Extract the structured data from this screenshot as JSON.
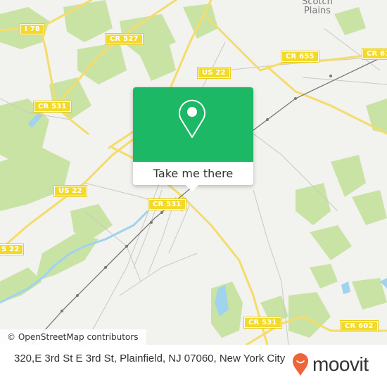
{
  "map": {
    "place_labels": [
      {
        "id": "scotch-plains",
        "line1": "Scotch",
        "line2": "Plains"
      }
    ],
    "road_shields": [
      {
        "id": "i78",
        "label": "I 78"
      },
      {
        "id": "cr527",
        "label": "CR 527"
      },
      {
        "id": "cr531-nw",
        "label": "CR 531"
      },
      {
        "id": "us22-n",
        "label": "US 22"
      },
      {
        "id": "cr655",
        "label": "CR 655"
      },
      {
        "id": "cr61x",
        "label": "CR 61"
      },
      {
        "id": "us22-w",
        "label": "US 22"
      },
      {
        "id": "us22-edge",
        "label": "S 22"
      },
      {
        "id": "cr531-center",
        "label": "CR 531"
      },
      {
        "id": "cr531-south",
        "label": "CR 531"
      },
      {
        "id": "cr602",
        "label": "CR 602"
      }
    ],
    "colors": {
      "background": "#f2f2ef",
      "park": "#c9e3a4",
      "water": "#9fd3ee",
      "major_road": "#f5dc6a",
      "minor_road": "#c8c8c4",
      "rail": "#777777"
    }
  },
  "popup": {
    "icon": "location-pin-icon",
    "button_label": "Take me there",
    "color": "#1cb865"
  },
  "attribution": "© OpenStreetMap contributors",
  "footer": {
    "address": "320,E 3rd St E 3rd St, Plainfield, NJ 07060, New York City",
    "logo_text": "moovit",
    "logo_color": "#f0643a"
  }
}
